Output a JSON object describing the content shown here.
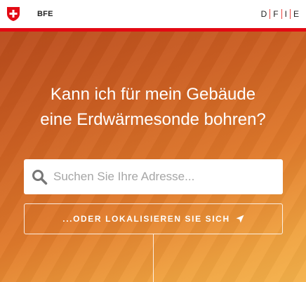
{
  "header": {
    "agency": "BFE",
    "languages": [
      "D",
      "F",
      "I",
      "E"
    ]
  },
  "hero": {
    "question_line1": "Kann ich für mein Gebäude",
    "question_line2": "eine Erdwärmesonde bohren?",
    "search_placeholder": "Suchen Sie Ihre Adresse...",
    "locate_label": "...ODER LOKALISIEREN SIE SICH"
  },
  "colors": {
    "brand_red": "#e30a14",
    "hero_top": "#b94b1c",
    "hero_bottom": "#f5b24b"
  },
  "icons": [
    "swiss-shield-icon",
    "search-icon",
    "location-arrow-icon"
  ]
}
